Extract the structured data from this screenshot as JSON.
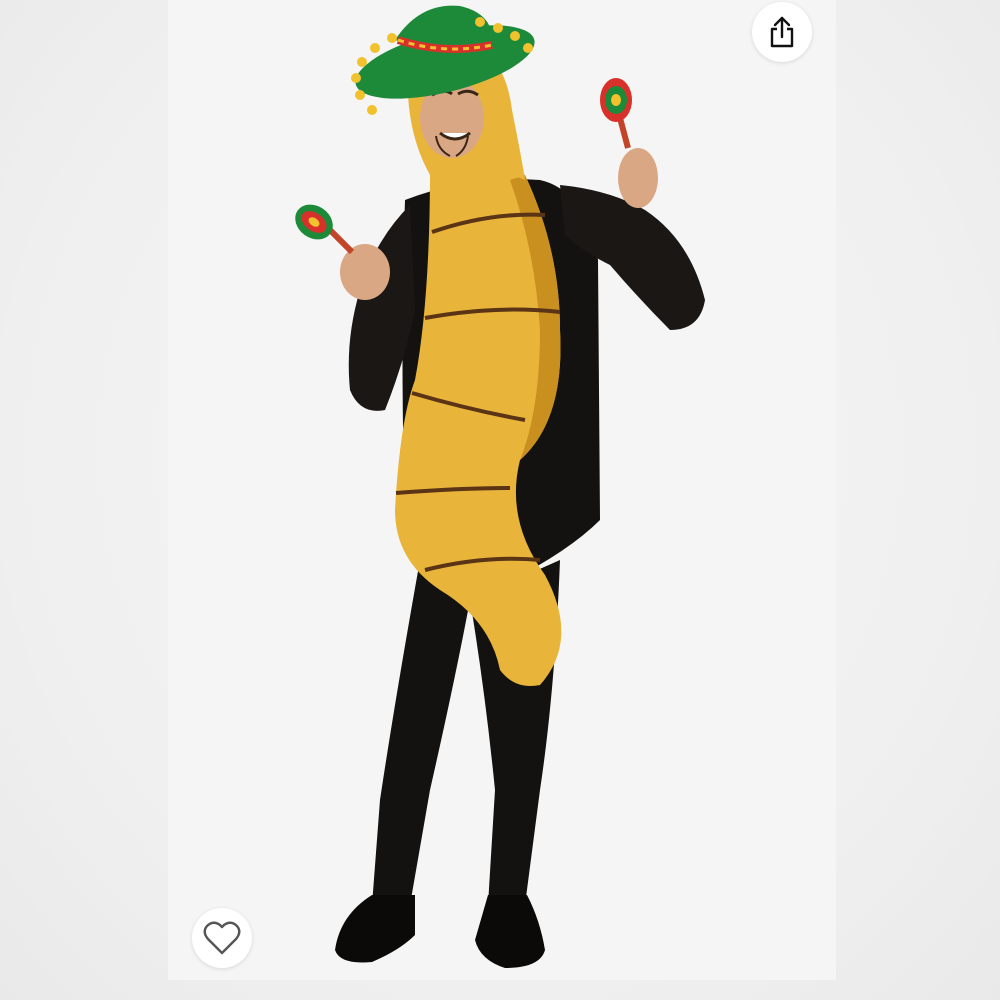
{
  "viewer": {
    "share_button": {
      "icon": "share-icon"
    },
    "like_button": {
      "icon": "heart-outline-icon",
      "liked": false
    }
  },
  "photo": {
    "subject": "worm-costume-with-sombrero-and-maracas",
    "colors": {
      "costume_yellow": "#e8b53a",
      "costume_shade": "#c99020",
      "stripe_brown": "#5a3414",
      "bodysuit_black": "#141210",
      "hat_green": "#1d8a3a",
      "skin": "#d9a784"
    }
  }
}
